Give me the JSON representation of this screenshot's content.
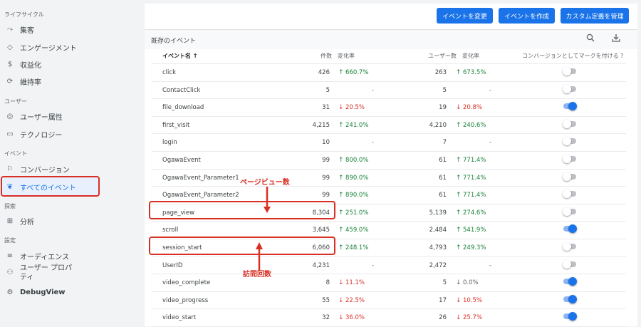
{
  "sidebar": {
    "sections": [
      {
        "title": "ライフサイクル"
      },
      {
        "title": "ユーザー"
      },
      {
        "title": "イベント"
      },
      {
        "title": "探索"
      },
      {
        "title": "設定"
      }
    ],
    "items": [
      {
        "label": "集客",
        "icon": "acquisition-icon"
      },
      {
        "label": "エンゲージメント",
        "icon": "engagement-icon"
      },
      {
        "label": "収益化",
        "icon": "monetization-icon"
      },
      {
        "label": "維持率",
        "icon": "retention-icon"
      },
      {
        "label": "ユーザー属性",
        "icon": "demographics-icon"
      },
      {
        "label": "テクノロジー",
        "icon": "tech-icon"
      },
      {
        "label": "コンバージョン",
        "icon": "flag-icon"
      },
      {
        "label": "すべてのイベント",
        "icon": "events-icon"
      },
      {
        "label": "分析",
        "icon": "analysis-icon"
      },
      {
        "label": "オーディエンス",
        "icon": "audience-icon"
      },
      {
        "label": "ユーザー プロパティ",
        "icon": "user-property-icon"
      },
      {
        "label": "DebugView",
        "icon": "debug-icon"
      }
    ]
  },
  "toolbar": {
    "modify_event": "イベントを変更",
    "create_event": "イベントを作成",
    "manage_custom": "カスタム定義を管理"
  },
  "card": {
    "title": "既存のイベント",
    "search_icon": "search-icon",
    "download_icon": "download-icon"
  },
  "table": {
    "headers": {
      "event_name": "イベント名 ↑",
      "count": "件数",
      "change1": "変化率",
      "users": "ユーザー数",
      "change2": "変化率",
      "conversion": "コンバージョンとしてマークを付ける ?"
    },
    "rows": [
      {
        "name": "click",
        "count": "426",
        "c1_dir": "up",
        "c1_arrow": "↑",
        "c1": "660.7%",
        "users": "263",
        "c2_dir": "up",
        "c2_arrow": "↑",
        "c2": "673.5%",
        "conversion": false
      },
      {
        "name": "ContactClick",
        "count": "5",
        "c1_dir": "flat",
        "c1_arrow": "",
        "c1": "-",
        "users": "5",
        "c2_dir": "flat",
        "c2_arrow": "",
        "c2": "-",
        "conversion": false
      },
      {
        "name": "file_download",
        "count": "31",
        "c1_dir": "down",
        "c1_arrow": "↓",
        "c1": "20.5%",
        "users": "19",
        "c2_dir": "down",
        "c2_arrow": "↓",
        "c2": "20.8%",
        "conversion": true
      },
      {
        "name": "first_visit",
        "count": "4,215",
        "c1_dir": "up",
        "c1_arrow": "↑",
        "c1": "241.0%",
        "users": "4,210",
        "c2_dir": "up",
        "c2_arrow": "↑",
        "c2": "240.6%",
        "conversion": false
      },
      {
        "name": "login",
        "count": "10",
        "c1_dir": "flat",
        "c1_arrow": "",
        "c1": "-",
        "users": "7",
        "c2_dir": "flat",
        "c2_arrow": "",
        "c2": "-",
        "conversion": false
      },
      {
        "name": "OgawaEvent",
        "count": "99",
        "c1_dir": "up",
        "c1_arrow": "↑",
        "c1": "800.0%",
        "users": "61",
        "c2_dir": "up",
        "c2_arrow": "↑",
        "c2": "771.4%",
        "conversion": false
      },
      {
        "name": "OgawaEvent_Parameter1",
        "count": "99",
        "c1_dir": "up",
        "c1_arrow": "↑",
        "c1": "890.0%",
        "users": "61",
        "c2_dir": "up",
        "c2_arrow": "↑",
        "c2": "771.4%",
        "conversion": false
      },
      {
        "name": "OgawaEvent_Parameter2",
        "count": "99",
        "c1_dir": "up",
        "c1_arrow": "↑",
        "c1": "890.0%",
        "users": "61",
        "c2_dir": "up",
        "c2_arrow": "↑",
        "c2": "771.4%",
        "conversion": false
      },
      {
        "name": "page_view",
        "count": "8,304",
        "c1_dir": "up",
        "c1_arrow": "↑",
        "c1": "251.0%",
        "users": "5,139",
        "c2_dir": "up",
        "c2_arrow": "↑",
        "c2": "274.6%",
        "conversion": false
      },
      {
        "name": "scroll",
        "count": "3,645",
        "c1_dir": "up",
        "c1_arrow": "↑",
        "c1": "459.0%",
        "users": "2,484",
        "c2_dir": "up",
        "c2_arrow": "↑",
        "c2": "541.9%",
        "conversion": true
      },
      {
        "name": "session_start",
        "count": "6,060",
        "c1_dir": "up",
        "c1_arrow": "↑",
        "c1": "248.1%",
        "users": "4,793",
        "c2_dir": "up",
        "c2_arrow": "↑",
        "c2": "249.3%",
        "conversion": false
      },
      {
        "name": "UserID",
        "count": "4,231",
        "c1_dir": "flat",
        "c1_arrow": "",
        "c1": "-",
        "users": "2,472",
        "c2_dir": "flat",
        "c2_arrow": "",
        "c2": "-",
        "conversion": false
      },
      {
        "name": "video_complete",
        "count": "8",
        "c1_dir": "down",
        "c1_arrow": "↓",
        "c1": "11.1%",
        "users": "5",
        "c2_dir": "flat",
        "c2_arrow": "↓",
        "c2": "0.0%",
        "conversion": true
      },
      {
        "name": "video_progress",
        "count": "55",
        "c1_dir": "down",
        "c1_arrow": "↓",
        "c1": "22.5%",
        "users": "17",
        "c2_dir": "down",
        "c2_arrow": "↓",
        "c2": "10.5%",
        "conversion": true
      },
      {
        "name": "video_start",
        "count": "32",
        "c1_dir": "down",
        "c1_arrow": "↓",
        "c1": "36.0%",
        "users": "26",
        "c2_dir": "down",
        "c2_arrow": "↓",
        "c2": "25.7%",
        "conversion": true
      }
    ]
  },
  "annotations": {
    "pageview_label": "ページビュー数",
    "session_label": "訪問回数"
  },
  "colors": {
    "accent": "#1a73e8",
    "highlight": "#d93025",
    "positive": "#188038",
    "negative": "#d93025"
  }
}
